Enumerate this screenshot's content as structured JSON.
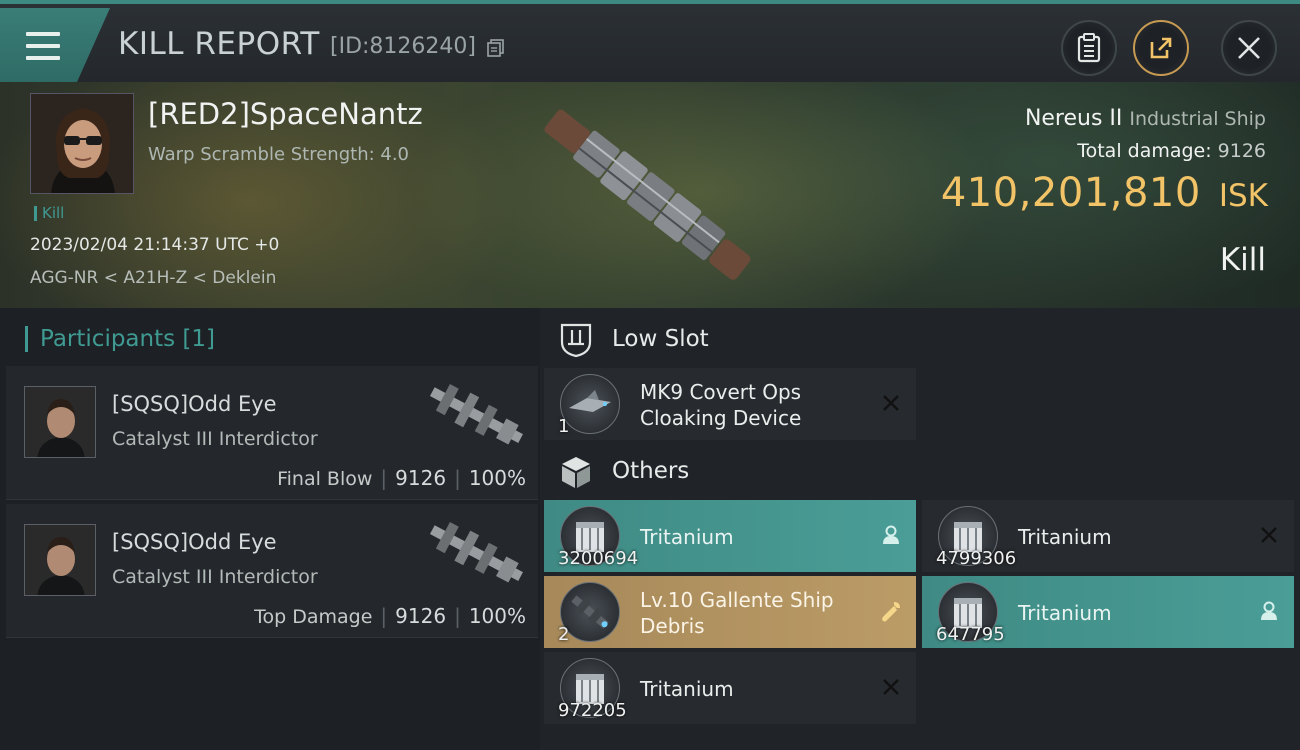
{
  "header": {
    "title": "KILL REPORT",
    "report_id": "[ID:8126240]",
    "buttons": [
      "clipboard-icon",
      "share-icon",
      "close-icon"
    ]
  },
  "victim": {
    "name": "[RED2]SpaceNantz",
    "warp_scramble": "Warp Scramble Strength: 4.0",
    "kill_tag": "Kill",
    "timestamp": "2023/02/04 21:14:37 UTC +0",
    "location": "AGG-NR < A21H-Z < Deklein",
    "ship_name": "Nereus II",
    "ship_class": "Industrial Ship",
    "damage_label": "Total damage:",
    "damage_value": "9126",
    "isk_value": "410,201,810",
    "isk_unit": "ISK",
    "status": "Kill"
  },
  "participants": {
    "header": "Participants [1]",
    "rows": [
      {
        "name": "[SQSQ]Odd Eye",
        "ship": "Catalyst III Interdictor",
        "role": "Final Blow",
        "damage": "9126",
        "percent": "100%"
      },
      {
        "name": "[SQSQ]Odd Eye",
        "ship": "Catalyst III Interdictor",
        "role": "Top Damage",
        "damage": "9126",
        "percent": "100%"
      }
    ]
  },
  "sections": {
    "low_slot": {
      "title": "Low Slot",
      "items": [
        {
          "name_line1": "MK9 Covert Ops",
          "name_line2": "Cloaking Device",
          "qty": "1",
          "state": "destroyed",
          "action_icon": "close-icon"
        }
      ]
    },
    "others": {
      "title": "Others",
      "items": [
        {
          "name": "Tritanium",
          "qty": "3200694",
          "state": "dropped",
          "action_icon": "person-icon"
        },
        {
          "name": "Tritanium",
          "qty": "4799306",
          "state": "destroyed",
          "action_icon": "close-icon"
        },
        {
          "name_line1": "Lv.10 Gallente Ship",
          "name_line2": "Debris",
          "qty": "2",
          "state": "salvage",
          "action_icon": "wrench-icon"
        },
        {
          "name": "Tritanium",
          "qty": "647795",
          "state": "dropped",
          "action_icon": "person-icon"
        },
        {
          "name": "Tritanium",
          "qty": "972205",
          "state": "destroyed",
          "action_icon": "close-icon"
        }
      ]
    }
  },
  "colors": {
    "accent_teal": "#3f9a92",
    "isk_gold": "#f2c467",
    "dropped_bg": "#46968f",
    "salvage_bg": "#b2935f"
  }
}
